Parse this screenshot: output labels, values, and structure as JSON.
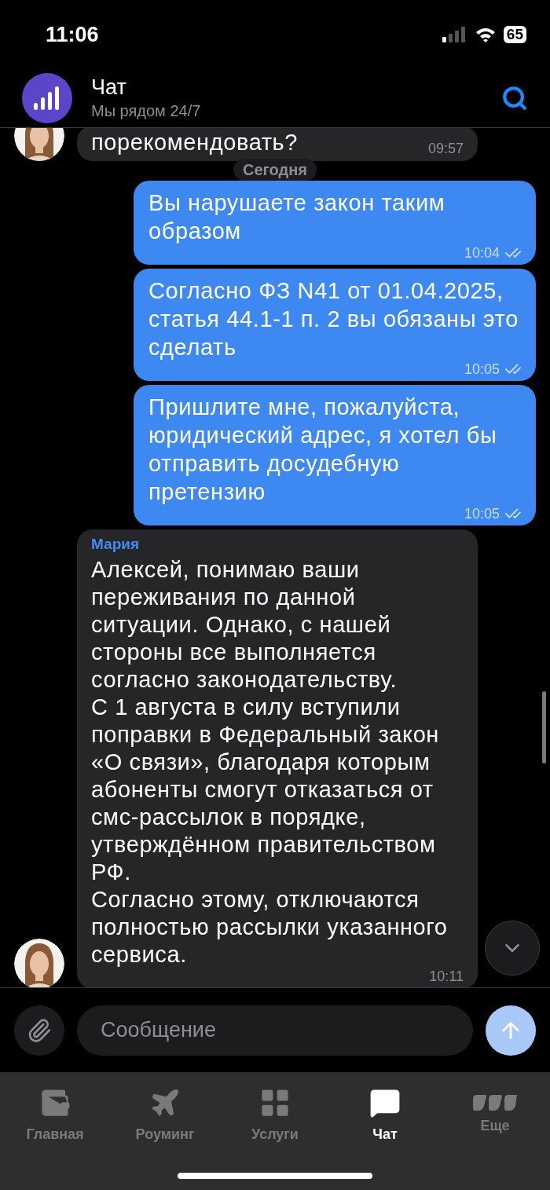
{
  "status_bar": {
    "time": "11:06",
    "battery": "65"
  },
  "header": {
    "title": "Чат",
    "subtitle": "Мы рядом 24/7"
  },
  "messages": [
    {
      "kind": "incoming",
      "text": "порекомендовать?",
      "time": "09:57",
      "avatar": true
    },
    {
      "kind": "date",
      "text": "Сегодня"
    },
    {
      "kind": "outgoing",
      "text": "Вы нарушаете закон таким образом",
      "time": "10:04",
      "read": true
    },
    {
      "kind": "outgoing",
      "text": "Согласно ФЗ N41 от 01.04.2025, статья 44.1-1 п. 2 вы обязаны это сделать",
      "time": "10:05",
      "read": true
    },
    {
      "kind": "outgoing",
      "text": "Пришлите мне, пожалуйста, юридический адрес, я хотел бы отправить досудебную претензию",
      "time": "10:05",
      "read": true
    },
    {
      "kind": "incoming",
      "sender": "Мария",
      "text": "Алексей, понимаю ваши переживания по данной ситуации. Однако, с нашей стороны все выполняется согласно законодательству.\nС 1 августа в силу вступили поправки в Федеральный закон «О связи», благодаря которым абоненты смогут отказаться от смс-рассылок в порядке, утверждённом правительством РФ.\nСогласно этому, отключаются полностью рассылки указанного сервиса.",
      "time": "10:11",
      "avatar": true
    }
  ],
  "composer": {
    "placeholder": "Сообщение"
  },
  "tabs": [
    {
      "label": "Главная",
      "selected": false
    },
    {
      "label": "Роуминг",
      "selected": false
    },
    {
      "label": "Услуги",
      "selected": false
    },
    {
      "label": "Чат",
      "selected": true
    },
    {
      "label": "Еще",
      "selected": false
    }
  ]
}
